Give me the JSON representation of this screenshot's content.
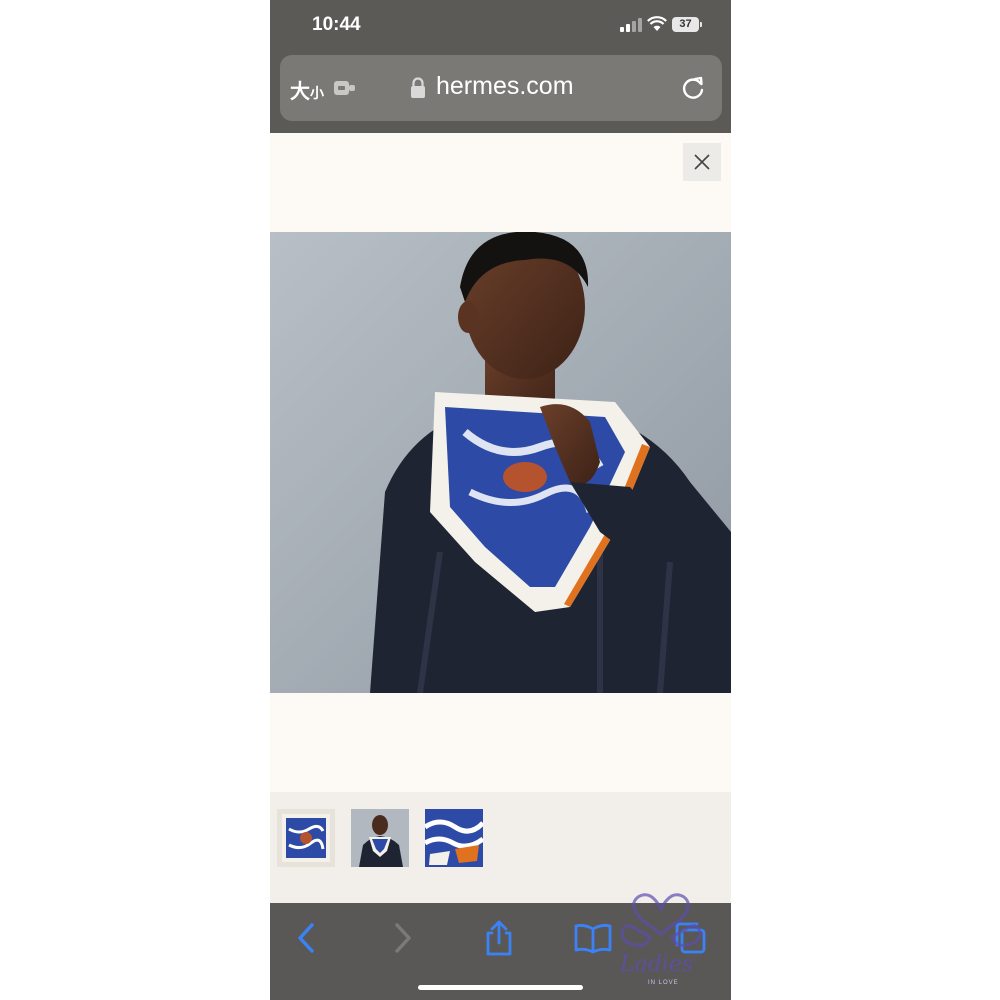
{
  "status_bar": {
    "time": "10:44",
    "battery": "37"
  },
  "address_bar": {
    "size_label": "大",
    "size_label_small": "小",
    "url": "hermes.com"
  },
  "product": {
    "thumbnails": [
      {
        "name": "scarf-flat-thumbnail"
      },
      {
        "name": "model-wearing-thumbnail"
      },
      {
        "name": "scarf-detail-thumbnail"
      }
    ]
  },
  "watermark": {
    "text": "Ladies",
    "subtext": "IN LOVE"
  },
  "colors": {
    "status_bar": "#5b5a57",
    "page_bg": "#fdfaf5",
    "toolbar_icon": "#3a82f6",
    "scarf_blue": "#2c4aa6",
    "scarf_border": "#e0711f"
  }
}
